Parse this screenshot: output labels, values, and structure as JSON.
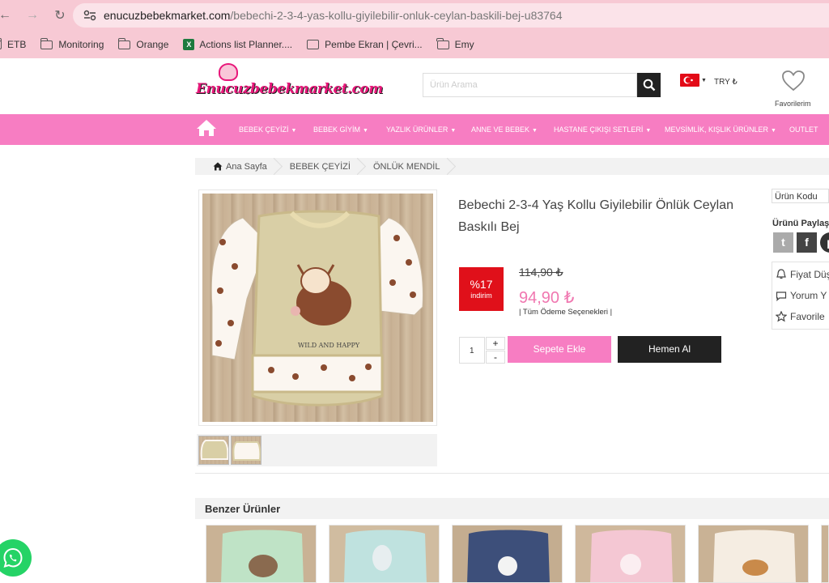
{
  "browser": {
    "url_domain": "enucuzbebekmarket.com",
    "url_path": "/bebechi-2-3-4-yas-kollu-giyilebilir-onluk-ceylan-baskili-bej-u83764",
    "bookmarks": [
      "ETB",
      "Monitoring",
      "Orange",
      "Actions list Planner....",
      "Pembe Ekran | Çevri...",
      "Emy"
    ]
  },
  "header": {
    "logo_text": "Enucuzbebekmarket.com",
    "search_placeholder": "Ürün Arama",
    "currency": "TRY ₺",
    "favorites_label": "Favorilerim"
  },
  "menu": {
    "items": [
      "BEBEK ÇEYİZİ",
      "BEBEK GİYİM",
      "YAZLIK ÜRÜNLER",
      "ANNE VE BEBEK",
      "HASTANE ÇIKIŞI SETLERİ",
      "MEVSİMLİK, KIŞLIK ÜRÜNLER",
      "OUTLET"
    ]
  },
  "breadcrumb": [
    "Ana Sayfa",
    "BEBEK ÇEYİZİ",
    "ÖNLÜK MENDİL"
  ],
  "product": {
    "title": "Bebechi 2-3-4 Yaş Kollu Giyilebilir Önlük Ceylan Baskılı Bej",
    "discount_pct": "%17",
    "discount_label": "indirim",
    "old_price": "114,90 ₺",
    "new_price": "94,90 ₺",
    "payment_options": "| Tüm Ödeme Seçenekleri |",
    "quantity": "1",
    "qty_plus": "+",
    "qty_minus": "-",
    "add_to_cart": "Sepete Ekle",
    "buy_now": "Hemen Al",
    "image_text": "WILD AND HAPPY"
  },
  "sidebar": {
    "code_label": "Ürün Kodu",
    "share_label": "Ürünü Paylaş",
    "links": [
      "Fiyat Düş",
      "Yorum Y",
      "Favorile"
    ]
  },
  "similar": {
    "title": "Benzer Ürünler"
  },
  "colors": {
    "pink": "#f77dc2",
    "chrome": "#f7c9d4",
    "discount_red": "#e0101a",
    "price_pink": "#f077b0"
  }
}
